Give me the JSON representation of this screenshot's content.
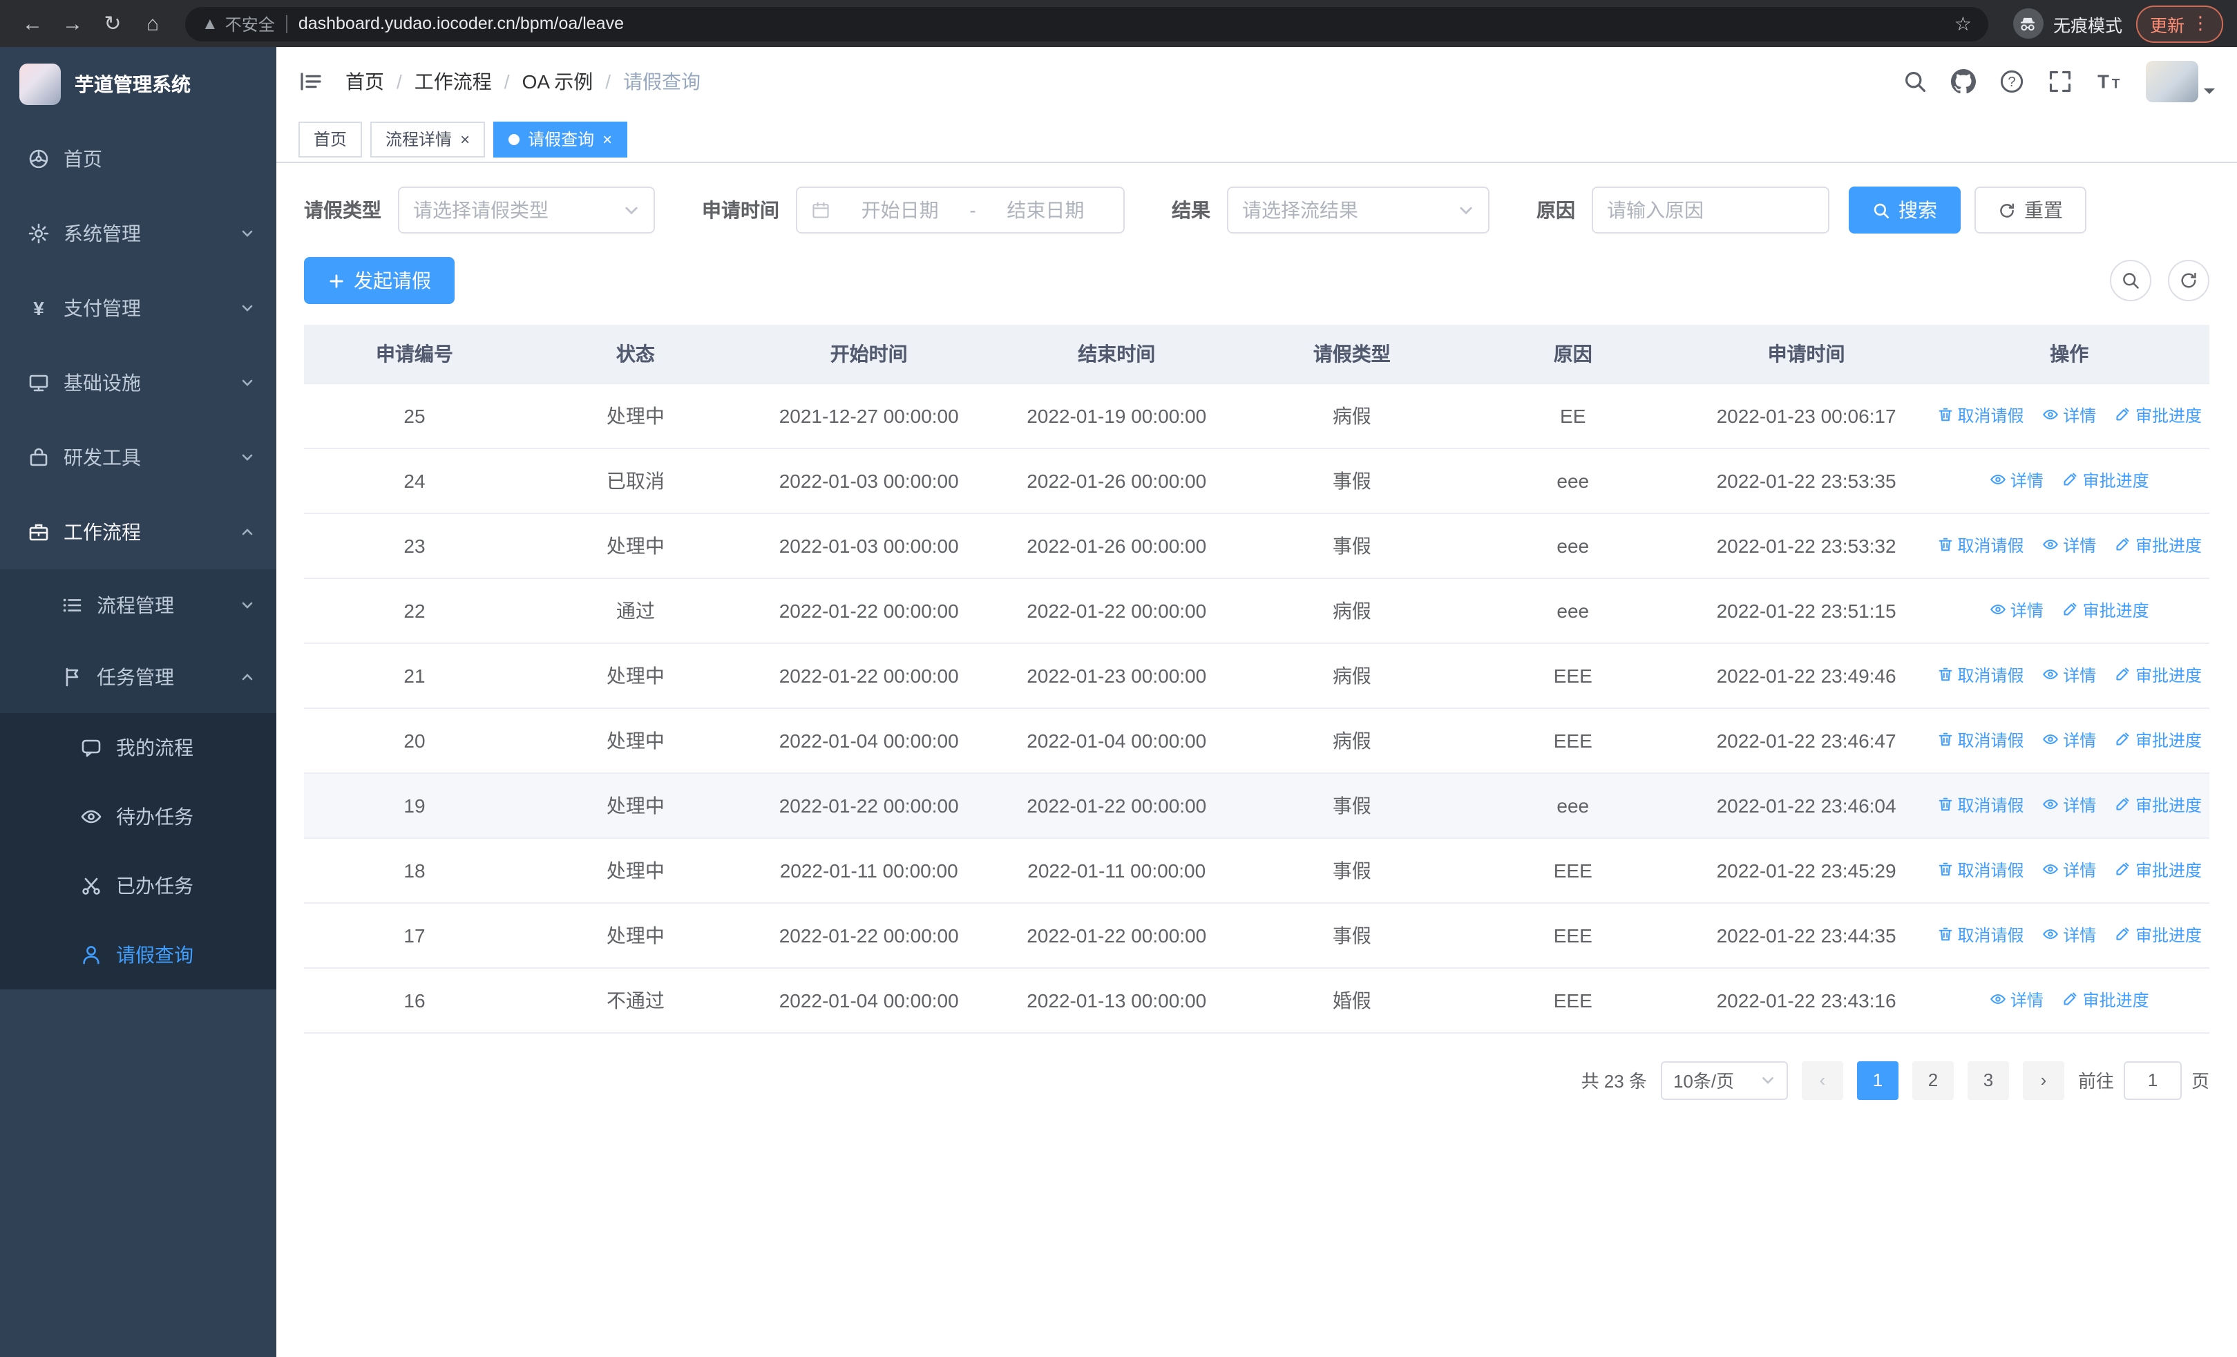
{
  "browser": {
    "security_label": "不安全",
    "url": "dashboard.yudao.iocoder.cn/bpm/oa/leave",
    "incognito_label": "无痕模式",
    "update_label": "更新"
  },
  "sidebar": {
    "logo_title": "芋道管理系统",
    "items": [
      {
        "label": "首页",
        "icon": "home-icon",
        "level": 1
      },
      {
        "label": "系统管理",
        "icon": "gear-icon",
        "level": 1,
        "chevron": "down"
      },
      {
        "label": "支付管理",
        "icon": "payment-icon",
        "level": 1,
        "chevron": "down"
      },
      {
        "label": "基础设施",
        "icon": "monitor-icon",
        "level": 1,
        "chevron": "down"
      },
      {
        "label": "研发工具",
        "icon": "toolbox-icon",
        "level": 1,
        "chevron": "down"
      },
      {
        "label": "工作流程",
        "icon": "briefcase-icon",
        "level": 1,
        "chevron": "up",
        "expanded": true
      },
      {
        "label": "流程管理",
        "icon": "list-icon",
        "level": 2,
        "chevron": "down"
      },
      {
        "label": "任务管理",
        "icon": "flag-icon",
        "level": 2,
        "chevron": "up",
        "expanded": true
      },
      {
        "label": "我的流程",
        "icon": "chat-icon",
        "level": 3
      },
      {
        "label": "待办任务",
        "icon": "eye-icon",
        "level": 3
      },
      {
        "label": "已办任务",
        "icon": "scissors-icon",
        "level": 3
      },
      {
        "label": "请假查询",
        "icon": "user-icon",
        "level": 3,
        "active": true
      }
    ]
  },
  "header": {
    "breadcrumb": [
      "首页",
      "工作流程",
      "OA 示例",
      "请假查询"
    ]
  },
  "tabs": [
    {
      "label": "首页"
    },
    {
      "label": "流程详情",
      "closable": true
    },
    {
      "label": "请假查询",
      "closable": true,
      "active": true
    }
  ],
  "filters": {
    "leave_type_label": "请假类型",
    "leave_type_placeholder": "请选择请假类型",
    "apply_time_label": "申请时间",
    "start_date_placeholder": "开始日期",
    "range_separator": "-",
    "end_date_placeholder": "结束日期",
    "result_label": "结果",
    "result_placeholder": "请选择流结果",
    "reason_label": "原因",
    "reason_placeholder": "请输入原因",
    "search_button": "搜索",
    "reset_button": "重置"
  },
  "toolbar": {
    "create_button": "发起请假"
  },
  "table": {
    "columns": [
      "申请编号",
      "状态",
      "开始时间",
      "结束时间",
      "请假类型",
      "原因",
      "申请时间",
      "操作"
    ],
    "actions": {
      "cancel": "取消请假",
      "detail": "详情",
      "progress": "审批进度"
    },
    "rows": [
      {
        "id": "25",
        "status": "处理中",
        "start": "2021-12-27 00:00:00",
        "end": "2022-01-19 00:00:00",
        "type": "病假",
        "reason": "EE",
        "applied": "2022-01-23 00:06:17"
      },
      {
        "id": "24",
        "status": "已取消",
        "start": "2022-01-03 00:00:00",
        "end": "2022-01-26 00:00:00",
        "type": "事假",
        "reason": "eee",
        "applied": "2022-01-22 23:53:35"
      },
      {
        "id": "23",
        "status": "处理中",
        "start": "2022-01-03 00:00:00",
        "end": "2022-01-26 00:00:00",
        "type": "事假",
        "reason": "eee",
        "applied": "2022-01-22 23:53:32"
      },
      {
        "id": "22",
        "status": "通过",
        "start": "2022-01-22 00:00:00",
        "end": "2022-01-22 00:00:00",
        "type": "病假",
        "reason": "eee",
        "applied": "2022-01-22 23:51:15"
      },
      {
        "id": "21",
        "status": "处理中",
        "start": "2022-01-22 00:00:00",
        "end": "2022-01-23 00:00:00",
        "type": "病假",
        "reason": "EEE",
        "applied": "2022-01-22 23:49:46"
      },
      {
        "id": "20",
        "status": "处理中",
        "start": "2022-01-04 00:00:00",
        "end": "2022-01-04 00:00:00",
        "type": "病假",
        "reason": "EEE",
        "applied": "2022-01-22 23:46:47"
      },
      {
        "id": "19",
        "status": "处理中",
        "start": "2022-01-22 00:00:00",
        "end": "2022-01-22 00:00:00",
        "type": "事假",
        "reason": "eee",
        "applied": "2022-01-22 23:46:04"
      },
      {
        "id": "18",
        "status": "处理中",
        "start": "2022-01-11 00:00:00",
        "end": "2022-01-11 00:00:00",
        "type": "事假",
        "reason": "EEE",
        "applied": "2022-01-22 23:45:29"
      },
      {
        "id": "17",
        "status": "处理中",
        "start": "2022-01-22 00:00:00",
        "end": "2022-01-22 00:00:00",
        "type": "事假",
        "reason": "EEE",
        "applied": "2022-01-22 23:44:35"
      },
      {
        "id": "16",
        "status": "不通过",
        "start": "2022-01-04 00:00:00",
        "end": "2022-01-13 00:00:00",
        "type": "婚假",
        "reason": "EEE",
        "applied": "2022-01-22 23:43:16"
      }
    ]
  },
  "pagination": {
    "total": "共 23 条",
    "page_size": "10条/页",
    "pages": [
      "1",
      "2",
      "3"
    ],
    "active_page": "1",
    "goto_label": "前往",
    "goto_value": "1",
    "page_unit": "页"
  },
  "colors": {
    "primary": "#409eff",
    "sidebar_bg": "#304156",
    "submenu_bg": "#1f2d3d",
    "chrome_bg": "#2c2d31",
    "update_chip": "#ff8e75"
  }
}
